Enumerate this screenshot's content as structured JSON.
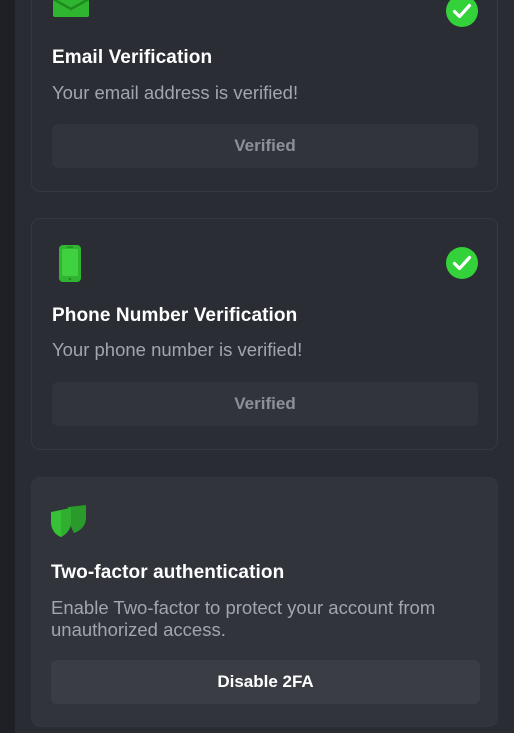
{
  "cards": {
    "email": {
      "title": "Email Verification",
      "description": "Your email address is verified!",
      "button_label": "Verified",
      "icon": "envelope-icon",
      "status_icon": "check-circle-icon"
    },
    "phone": {
      "title": "Phone Number Verification",
      "description": "Your phone number is verified!",
      "button_label": "Verified",
      "icon": "phone-icon",
      "status_icon": "check-circle-icon"
    },
    "twofa": {
      "title": "Two-factor authentication",
      "description": "Enable Two-factor to protect your account from unauthorized access.",
      "button_label": "Disable 2FA",
      "icon": "shield-icon"
    }
  },
  "colors": {
    "accent_green": "#2ecc40",
    "background": "#2a2c33",
    "card": "#2b2d34",
    "text_primary": "#ffffff",
    "text_secondary": "#a1a5b0"
  }
}
